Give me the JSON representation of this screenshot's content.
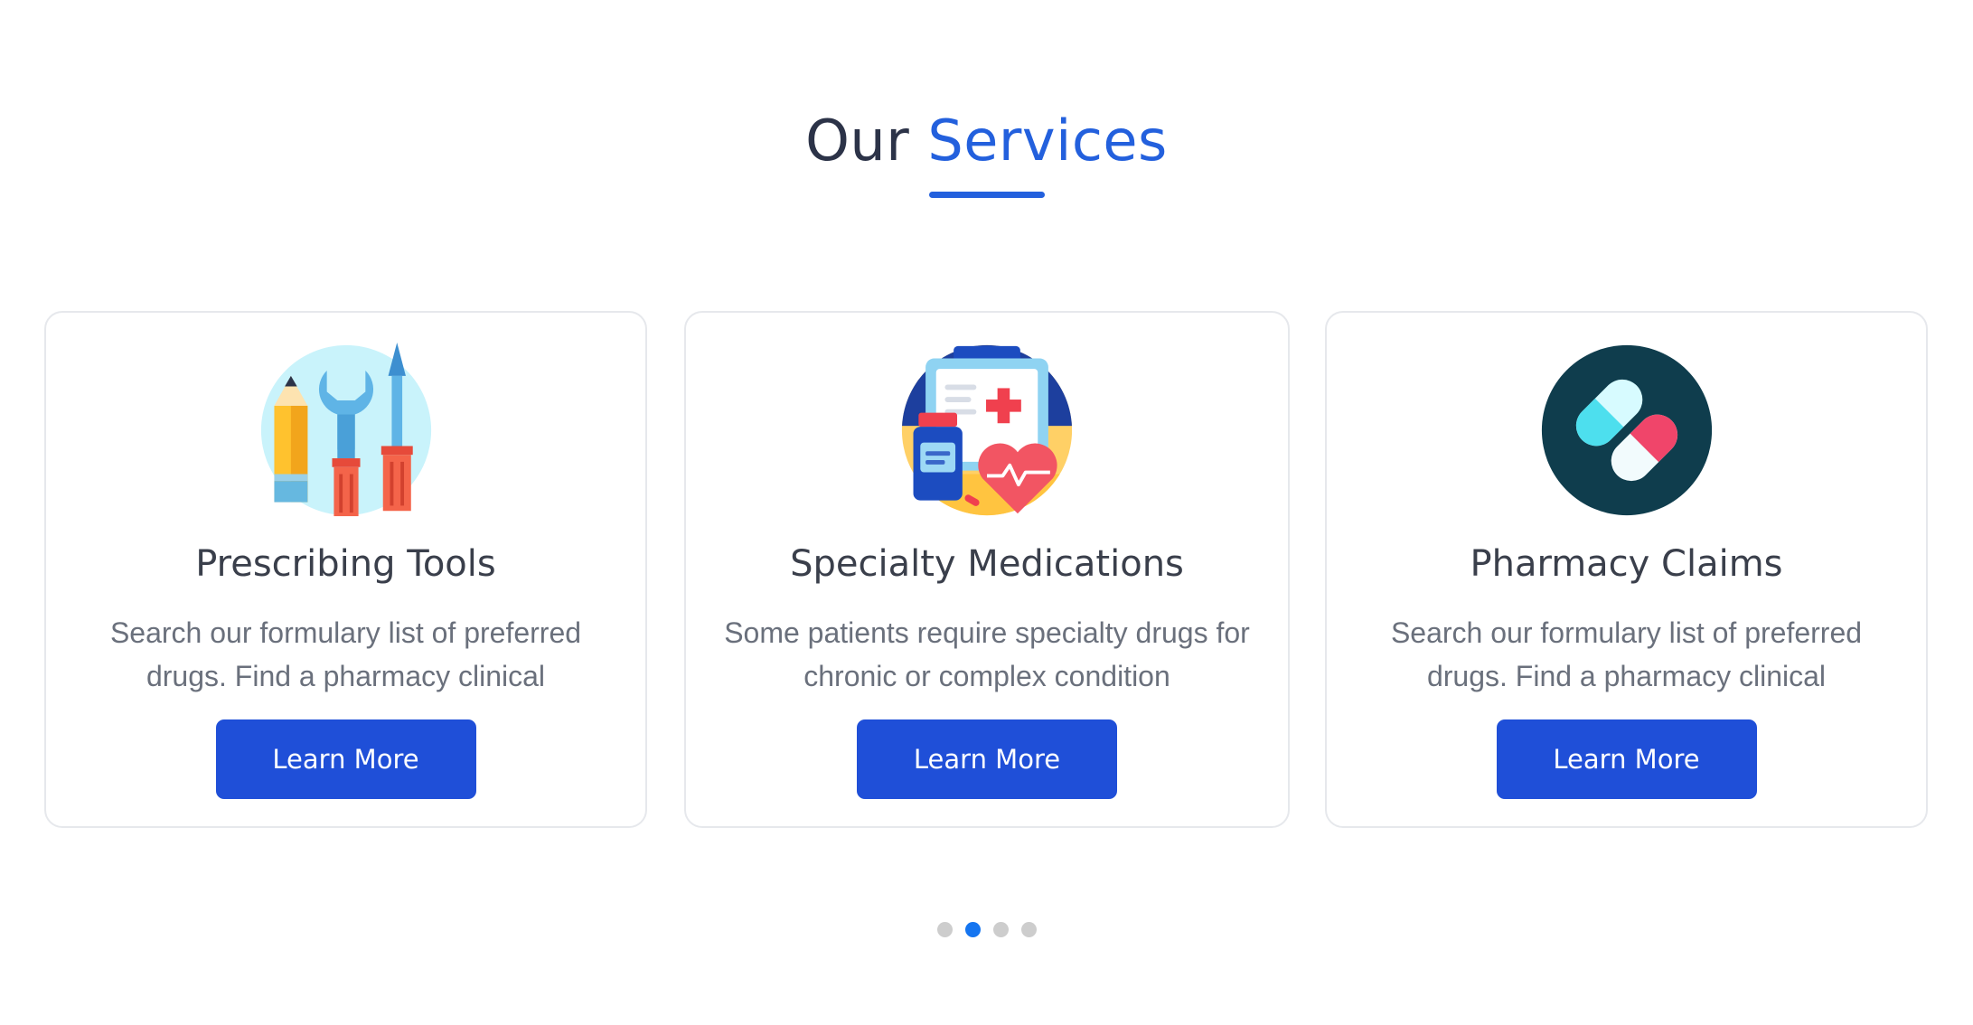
{
  "header": {
    "title_prefix": "Our",
    "title_accent": "Services"
  },
  "services": [
    {
      "icon": "tools-icon",
      "title": "Prescribing Tools",
      "description": "Search our formulary list of preferred drugs. Find a pharmacy clinical",
      "button_label": "Learn More"
    },
    {
      "icon": "medical-kit-icon",
      "title": "Specialty Medications",
      "description": "Some patients require specialty drugs for chronic or complex condition",
      "button_label": "Learn More"
    },
    {
      "icon": "pills-icon",
      "title": "Pharmacy Claims",
      "description": "Search our formulary list of preferred drugs. Find a pharmacy clinical",
      "button_label": "Learn More"
    }
  ],
  "pager": {
    "total": 4,
    "active_index": 1
  },
  "colors": {
    "accent": "#2360dd",
    "button": "#1f4fd8",
    "title_text": "#2c3348",
    "active_dot": "#1575f0",
    "inactive_dot": "#cdcdcd"
  }
}
